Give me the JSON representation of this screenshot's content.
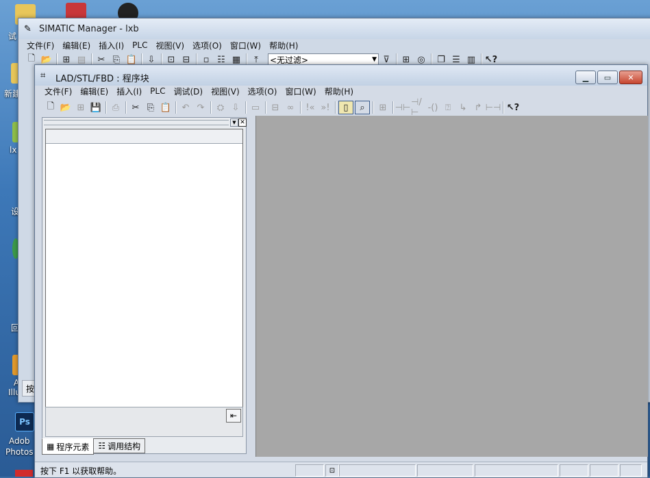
{
  "desktop": {
    "labels": {
      "shi": "试",
      "xinjian": "新建",
      "ix": "lx",
      "she": "设",
      "hui": "回",
      "an": "按",
      "illus": "A\nIllus",
      "adobe": "Adob\nPhotos"
    },
    "ps_icon": "Ps"
  },
  "simatic_window": {
    "title": "SIMATIC Manager - lxb",
    "menu": [
      "文件(F)",
      "编辑(E)",
      "插入(I)",
      "PLC",
      "视图(V)",
      "选项(O)",
      "窗口(W)",
      "帮助(H)"
    ],
    "filter_value": "<无过滤>"
  },
  "lad_window": {
    "title": "LAD/STL/FBD : 程序块",
    "menu": [
      "文件(F)",
      "编辑(E)",
      "插入(I)",
      "PLC",
      "调试(D)",
      "视图(V)",
      "选项(O)",
      "窗口(W)",
      "帮助(H)"
    ],
    "tabs": [
      {
        "label": "程序元素",
        "icon": "program-elements-icon"
      },
      {
        "label": "调用结构",
        "icon": "call-structure-icon"
      }
    ],
    "status_text": "按下 F1 以获取帮助。"
  },
  "colors": {
    "workspace": "#a7a7a7",
    "close_button": "#c6462f"
  }
}
